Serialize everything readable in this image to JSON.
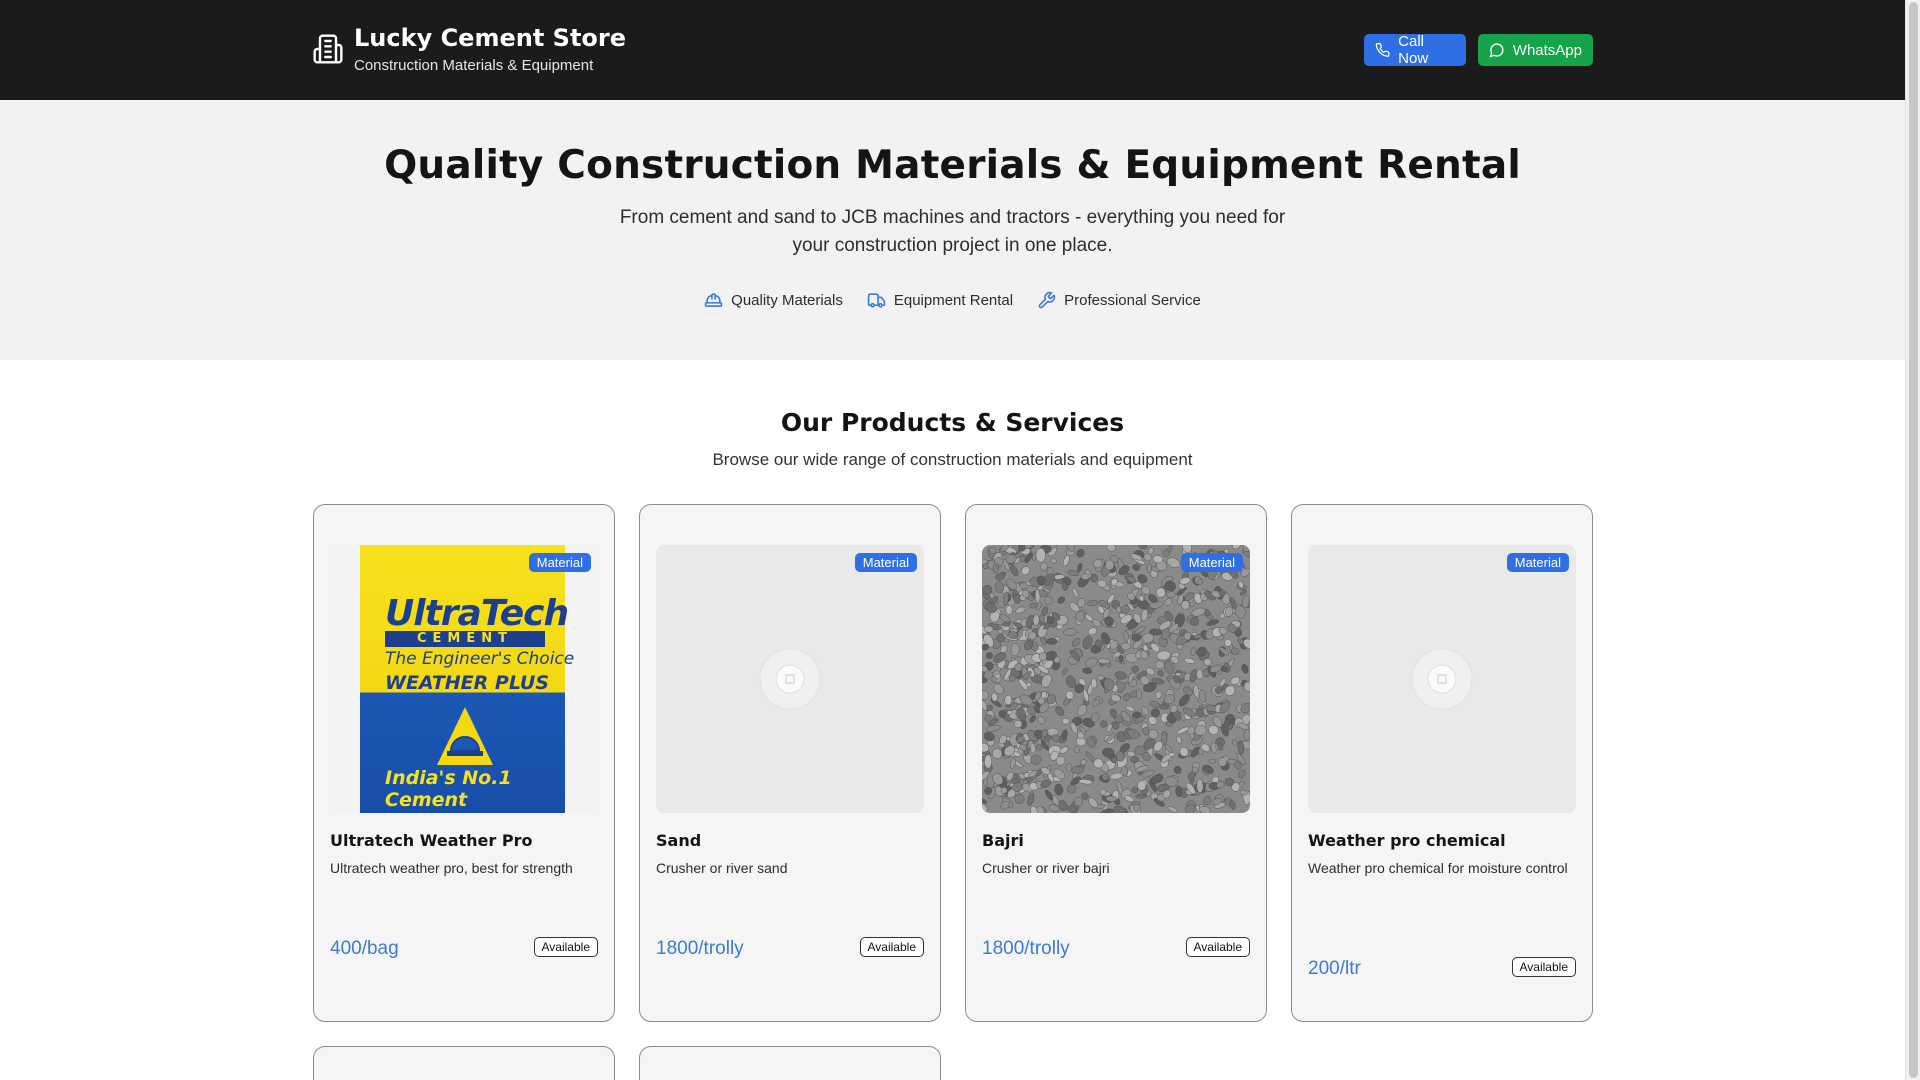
{
  "header": {
    "store_name": "Lucky Cement Store",
    "tagline": "Construction Materials & Equipment",
    "call_label": "Call Now",
    "whatsapp_label": "WhatsApp"
  },
  "hero": {
    "title": "Quality Construction Materials & Equipment Rental",
    "description": "From cement and sand to JCB machines and tractors - everything you need for your construction project in one place.",
    "features": [
      {
        "label": "Quality Materials",
        "icon": "hard-hat-icon"
      },
      {
        "label": "Equipment Rental",
        "icon": "truck-icon"
      },
      {
        "label": "Professional Service",
        "icon": "wrench-icon"
      }
    ]
  },
  "products": {
    "title": "Our Products & Services",
    "subtitle": "Browse our wide range of construction materials and equipment",
    "items": [
      {
        "name": "Ultratech Weather Pro",
        "description": "Ultratech weather pro, best for strength",
        "price": "400/bag",
        "category": "Material",
        "status": "Available",
        "image": "cement-bag"
      },
      {
        "name": "Sand",
        "description": "Crusher or river sand",
        "price": "1800/trolly",
        "category": "Material",
        "status": "Available",
        "image": "placeholder"
      },
      {
        "name": "Bajri",
        "description": "Crusher or river bajri",
        "price": "1800/trolly",
        "category": "Material",
        "status": "Available",
        "image": "gravel"
      },
      {
        "name": "Weather pro chemical",
        "description": "Weather pro chemical for moisture control",
        "price": "200/ltr",
        "category": "Material",
        "status": "Available",
        "image": "placeholder"
      }
    ]
  },
  "cement_bag_art": {
    "brand": "UltraTech",
    "cement": "CEMENT",
    "line1": "The Engineer's Choice",
    "line2": "WEATHER PLUS",
    "bottom": "India's No.1 Cement"
  },
  "colors": {
    "header_bg": "#1b1b1b",
    "accent_blue": "#2f6fe4",
    "whatsapp_green": "#16a34a",
    "price_blue": "#3a7bd5"
  }
}
